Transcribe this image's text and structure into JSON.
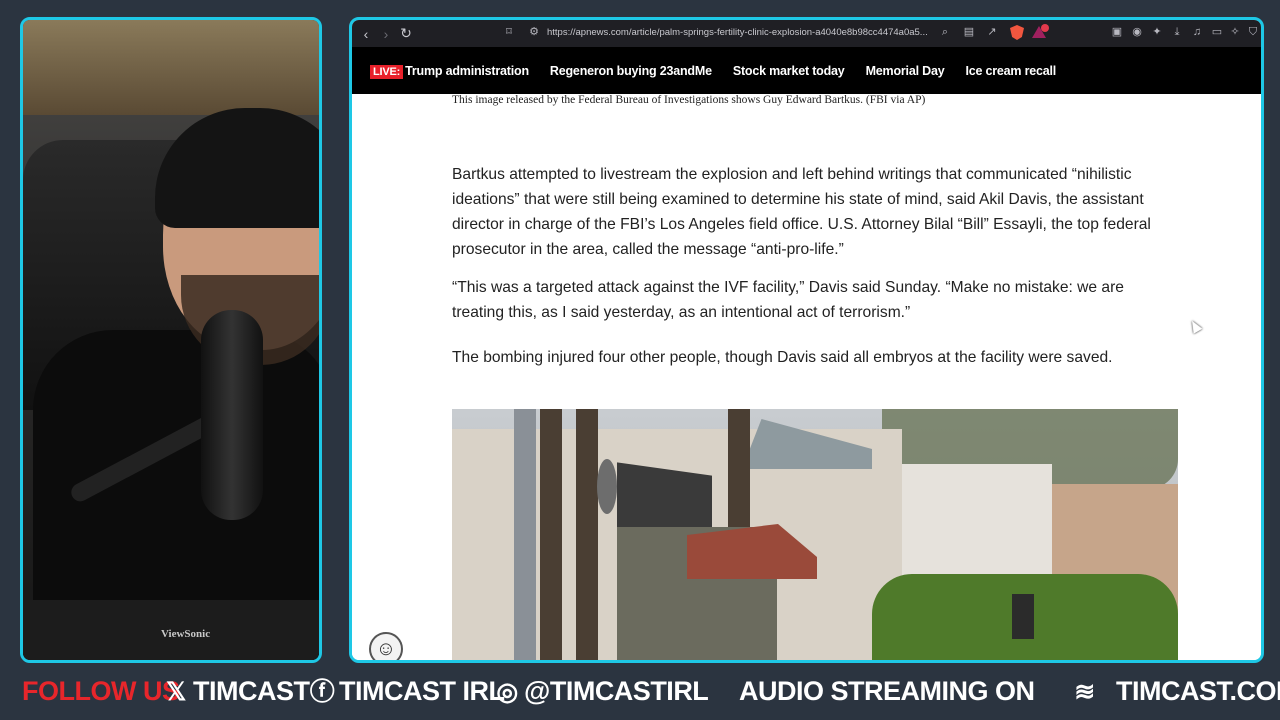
{
  "browser": {
    "url": "https://apnews.com/article/palm-springs-fertility-clinic-explosion-a4040e8b98cc4474a0a5..."
  },
  "news_nav": {
    "live_badge": "LIVE:",
    "items": [
      "Trump administration",
      "Regeneron buying 23andMe",
      "Stock market today",
      "Memorial Day",
      "Ice cream recall"
    ]
  },
  "article": {
    "caption": "This image released by the Federal Bureau of Investigations shows Guy Edward Bartkus. (FBI via AP)",
    "paragraphs": [
      "Bartkus attempted to livestream the explosion and left behind writings that communicated “nihilistic ideations” that were still being examined to determine his state of mind, said Akil Davis, the assistant director in charge of the FBI’s Los Angeles field office. U.S. Attorney Bilal “Bill” Essayli, the top federal prosecutor in the area, called the message “anti-pro-life.”",
      "“This was a targeted attack against the IVF facility,” Davis said Sunday. “Make no mistake: we are treating this, as I said yesterday, as an intentional act of terrorism.”",
      "The bombing injured four other people, though Davis said all embryos at the facility were saved."
    ]
  },
  "webcam": {
    "monitor_brand": "ViewSonic"
  },
  "footer": {
    "follow": "FOLLOW US",
    "x_handle": "TIMCAST",
    "fb_handle": "TIMCAST IRL",
    "ig_handle": "@TIMCASTIRL",
    "audio": "AUDIO STREAMING ON",
    "site": "TIMCAST.COM"
  },
  "colors": {
    "frame_border": "#1ec8e6",
    "follow_red": "#e8262b",
    "live_red": "#e8202a",
    "background": "#2b3440"
  }
}
